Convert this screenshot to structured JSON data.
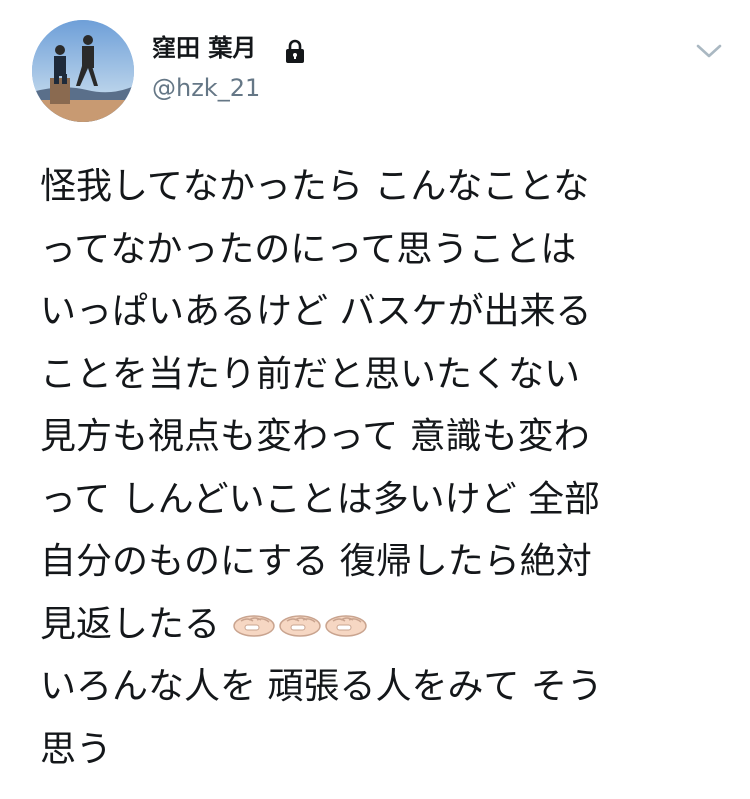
{
  "profile": {
    "display_name": "窪田 葉月",
    "handle": "@hzk_21",
    "avatar_icon": "avatar-photo",
    "protected_icon": "lock-icon"
  },
  "menu": {
    "icon": "chevron-down-icon"
  },
  "tweet": {
    "lines": [
      "怪我してなかったら こんなことな",
      "ってなかったのにって思うことは",
      "いっぱいあるけど バスケが出来る",
      "ことを当たり前だと思いたくない",
      "見方も視点も変わって 意識も変わ",
      "って しんどいことは多いけど 全部",
      "自分のものにする 復帰したら絶対",
      "見返したる",
      "いろんな人を 頑張る人をみて そう",
      "思う"
    ],
    "emoji": [
      "left-fist-emoji",
      "left-fist-emoji",
      "left-fist-emoji"
    ]
  },
  "colors": {
    "text": "#14171a",
    "secondary": "#657786",
    "chevron": "#aab8c2",
    "skin_tone": "#f6d7c3"
  }
}
